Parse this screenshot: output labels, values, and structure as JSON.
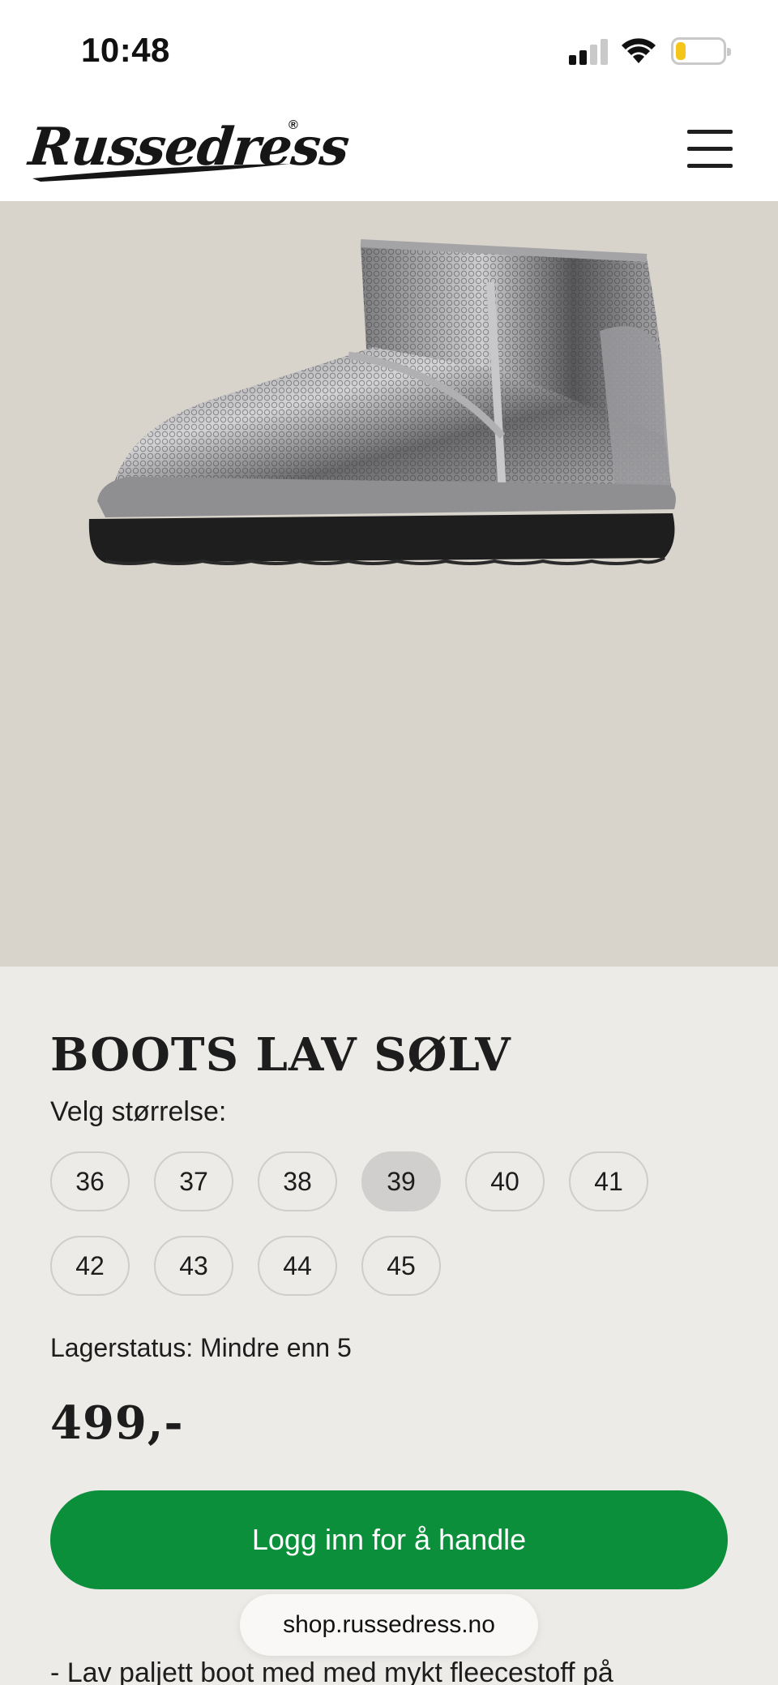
{
  "status_bar": {
    "time": "10:48",
    "battery_level": 0.22,
    "battery_color": "#f4c619"
  },
  "header": {
    "logo_text": "Russedress",
    "logo_mark": "®",
    "menu_icon": "hamburger-menu-icon"
  },
  "hero": {
    "background_color": "#d8d4cb",
    "image": "silver-sequin-boot"
  },
  "product": {
    "title": "BOOTS LAV SØLV",
    "size_label": "Velg størrelse:",
    "sizes": [
      "36",
      "37",
      "38",
      "39",
      "40",
      "41",
      "42",
      "43",
      "44",
      "45"
    ],
    "selected_size": "39",
    "stock_status": "Lagerstatus: Mindre enn 5",
    "price": "499,-",
    "buy_button_label": "Logg inn for å handle",
    "buy_button_color": "#0b8f3b",
    "description": "- Lav paljett boot med med mykt fleecestoff på"
  },
  "browser": {
    "url": "shop.russedress.no"
  }
}
